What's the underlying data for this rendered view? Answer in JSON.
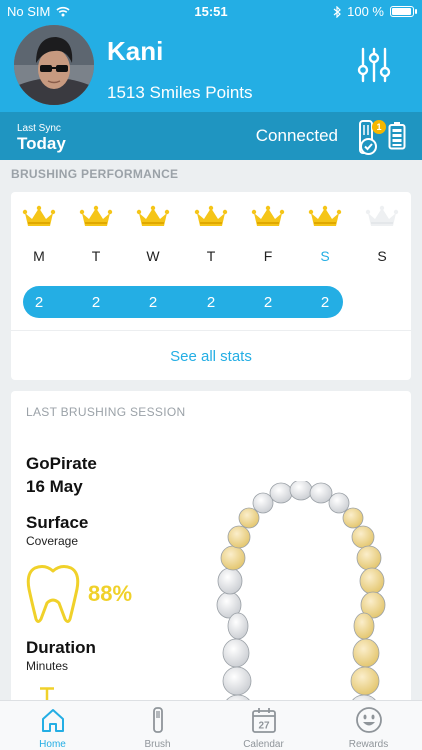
{
  "status_bar": {
    "carrier": "No SIM",
    "time": "15:51",
    "battery": "100 %",
    "battery_level": 1.0
  },
  "profile": {
    "name": "Kani",
    "points": "1513 Smiles Points"
  },
  "sync": {
    "label": "Last Sync",
    "value": "Today",
    "status": "Connected",
    "badge": "1"
  },
  "brushing": {
    "section_title": "BRUSHING PERFORMANCE",
    "days": [
      {
        "label": "M",
        "count": "2",
        "crown": true,
        "active": false
      },
      {
        "label": "T",
        "count": "2",
        "crown": true,
        "active": false
      },
      {
        "label": "W",
        "count": "2",
        "crown": true,
        "active": false
      },
      {
        "label": "T",
        "count": "2",
        "crown": true,
        "active": false
      },
      {
        "label": "F",
        "count": "2",
        "crown": true,
        "active": false
      },
      {
        "label": "S",
        "count": "2",
        "crown": true,
        "active": true
      },
      {
        "label": "S",
        "count": "",
        "crown": false,
        "active": false
      }
    ],
    "see_all": "See all stats"
  },
  "last_session": {
    "title": "LAST BRUSHING SESSION",
    "game": "GoPirate",
    "date": "16 May",
    "surface_label": "Surface",
    "surface_sub": "Coverage",
    "surface_value": "88%",
    "duration_label": "Duration",
    "duration_sub": "Minutes"
  },
  "tabs": [
    {
      "label": "Home",
      "icon": "home-icon",
      "active": true
    },
    {
      "label": "Brush",
      "icon": "toothbrush-icon",
      "active": false
    },
    {
      "label": "Calendar",
      "icon": "calendar-icon",
      "active": false,
      "icon_text": "27"
    },
    {
      "label": "Rewards",
      "icon": "smiley-icon",
      "active": false
    }
  ],
  "colors": {
    "primary": "#24aee4",
    "primary_dark": "#1f95c1",
    "gold": "#f5c518",
    "yellow": "#f0d12a"
  }
}
